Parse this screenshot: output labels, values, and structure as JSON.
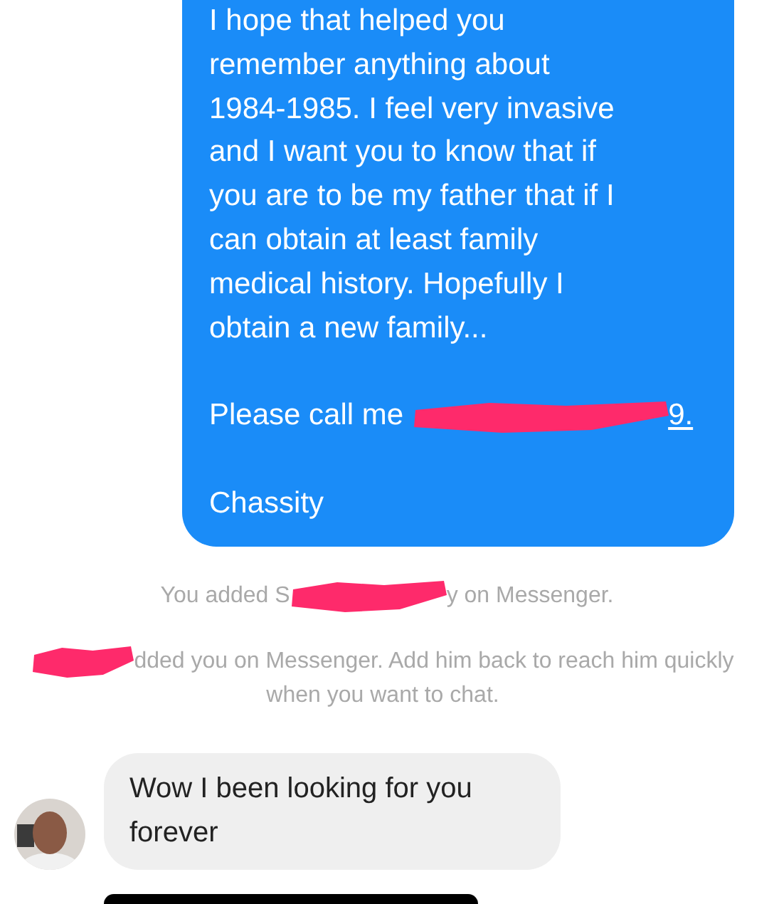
{
  "messages": [
    {
      "kind": "outgoing",
      "paragraphs": [
        {
          "text": "I hope that helped you\nremember anything about\n1984-1985. I feel very invasive\nand I want you to know that if\nyou are to be my father that if I\ncan obtain at least family\nmedical history. Hopefully I\nobtain a new family..."
        },
        {
          "text": "Please call me",
          "redacted": true,
          "after": "9."
        },
        {
          "text": "Chassity"
        }
      ]
    },
    {
      "kind": "system",
      "before": "You added S",
      "redacted": true,
      "after": "y on Messenger."
    },
    {
      "kind": "system",
      "redacted": true,
      "after": "dded you on Messenger. Add him back to reach him quickly when you want to chat."
    },
    {
      "kind": "incoming",
      "text": "Wow I been looking for you forever"
    },
    {
      "kind": "media"
    }
  ]
}
